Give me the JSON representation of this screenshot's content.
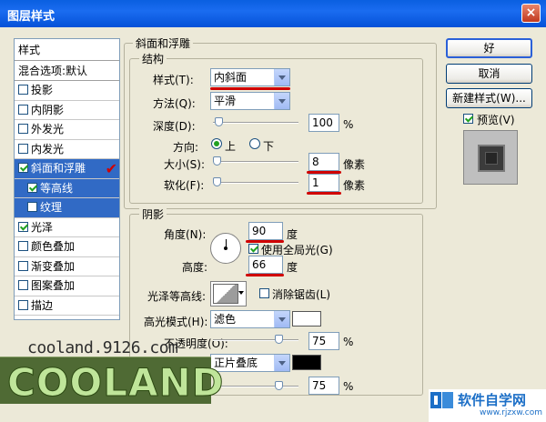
{
  "window": {
    "title": "图层样式",
    "close_label": "×"
  },
  "sidebar": {
    "header": "样式",
    "blend_options": "混合选项:默认",
    "items": [
      {
        "label": "投影",
        "checked": false
      },
      {
        "label": "内阴影",
        "checked": false
      },
      {
        "label": "外发光",
        "checked": false
      },
      {
        "label": "内发光",
        "checked": false
      },
      {
        "label": "斜面和浮雕",
        "checked": true
      },
      {
        "label": "等高线",
        "checked": true
      },
      {
        "label": "纹理",
        "checked": false
      },
      {
        "label": "光泽",
        "checked": true
      },
      {
        "label": "颜色叠加",
        "checked": false
      },
      {
        "label": "渐变叠加",
        "checked": false
      },
      {
        "label": "图案叠加",
        "checked": false
      },
      {
        "label": "描边",
        "checked": false
      }
    ],
    "check_mark": "✔"
  },
  "bevel": {
    "group_title": "斜面和浮雕",
    "structure_title": "结构",
    "style_label": "样式(T):",
    "style_value": "内斜面",
    "method_label": "方法(Q):",
    "method_value": "平滑",
    "depth_label": "深度(D):",
    "depth_value": "100",
    "depth_unit": "%",
    "direction_label": "方向:",
    "direction_up": "上",
    "direction_down": "下",
    "size_label": "大小(S):",
    "size_value": "8",
    "size_unit": "像素",
    "soften_label": "软化(F):",
    "soften_value": "1",
    "soften_unit": "像素"
  },
  "shading": {
    "title": "阴影",
    "angle_label": "角度(N):",
    "angle_value": "90",
    "angle_unit": "度",
    "global_light_label": "使用全局光(G)",
    "altitude_label": "高度:",
    "altitude_value": "66",
    "altitude_unit": "度",
    "gloss_contour_label": "光泽等高线:",
    "anti_alias_label": "消除锯齿(L)",
    "highlight_mode_label": "高光模式(H):",
    "highlight_mode_value": "滤色",
    "highlight_opacity_label": "不透明度(O):",
    "highlight_opacity_value": "75",
    "shadow_mode_value": "正片叠底",
    "shadow_opacity_value": "75",
    "percent": "%"
  },
  "buttons": {
    "ok": "好",
    "cancel": "取消",
    "new_style": "新建样式(W)...",
    "preview_label": "预览(V)"
  },
  "watermarks": {
    "url": "cooland.9126.com",
    "logo": "COOLAND",
    "site_cn": "软件自学网",
    "site_domain": "www.rjzxw.com"
  },
  "colors": {
    "highlight_swatch": "#FFFFFF",
    "shadow_swatch": "#000000",
    "selection": "#316AC5",
    "annotation_red": "#D00000"
  }
}
